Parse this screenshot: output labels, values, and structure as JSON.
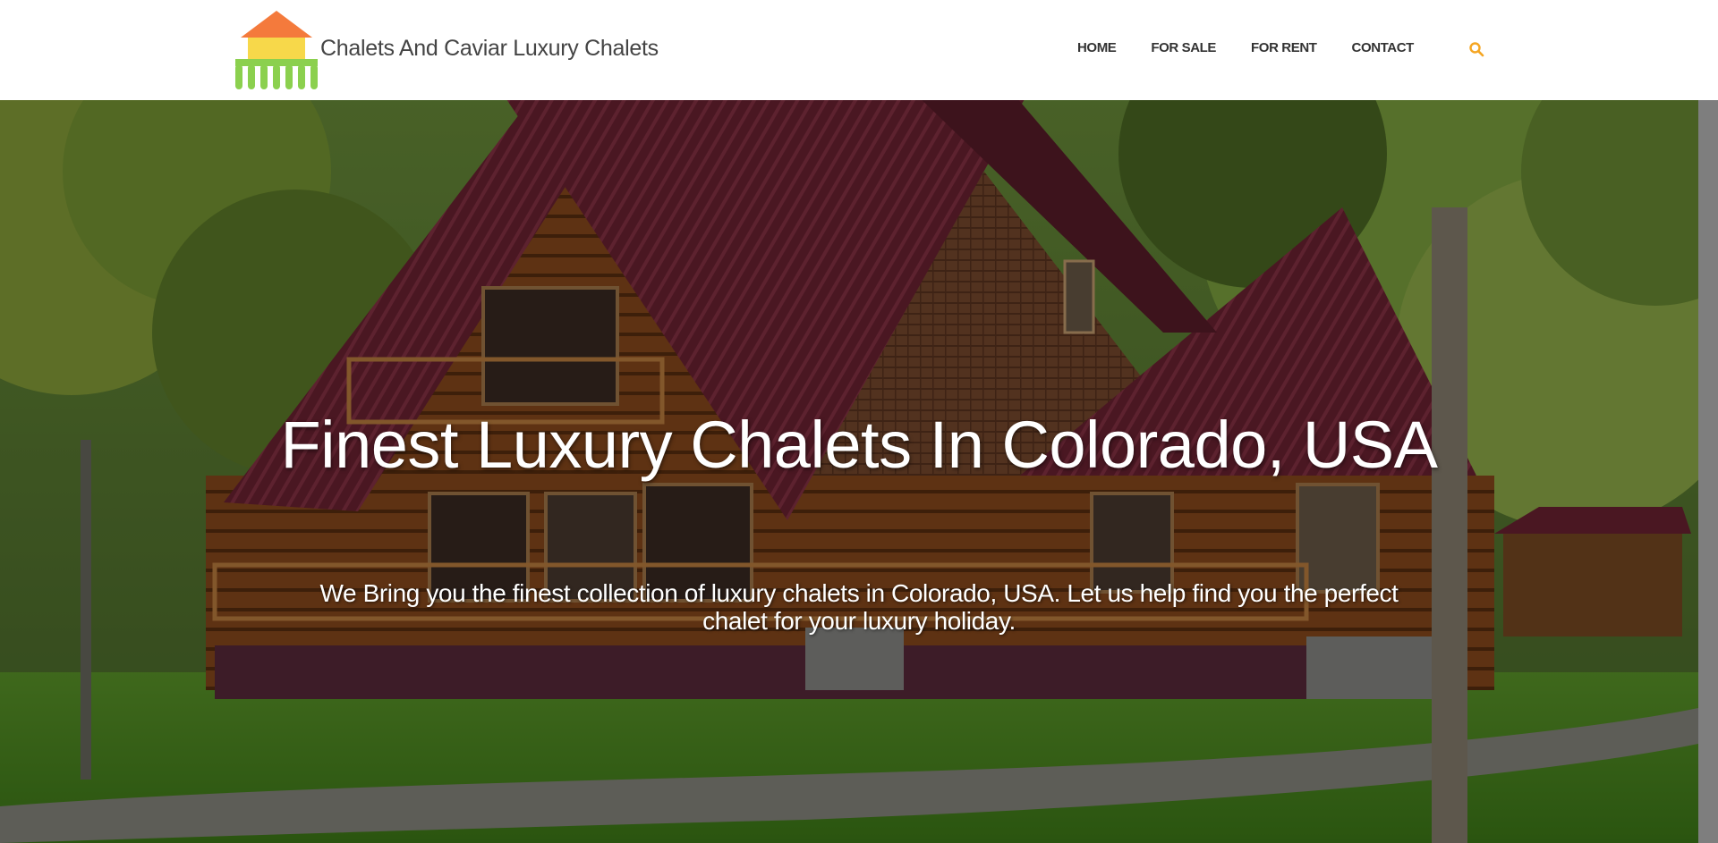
{
  "header": {
    "brand": "Chalets And Caviar Luxury Chalets",
    "nav": [
      {
        "label": "HOME"
      },
      {
        "label": "FOR SALE"
      },
      {
        "label": "FOR RENT"
      },
      {
        "label": "CONTACT"
      }
    ],
    "search_icon": "search-icon",
    "accent_color": "#f5a623"
  },
  "hero": {
    "title": "Finest Luxury Chalets In Colorado, USA",
    "subtitle": "We Bring you the finest collection of luxury chalets in Colorado, USA. Let us help find you the perfect chalet for your luxury holiday."
  },
  "colors": {
    "logo_roof": "#f47a3c",
    "logo_body": "#f7d84a",
    "logo_columns": "#8bd04e"
  }
}
